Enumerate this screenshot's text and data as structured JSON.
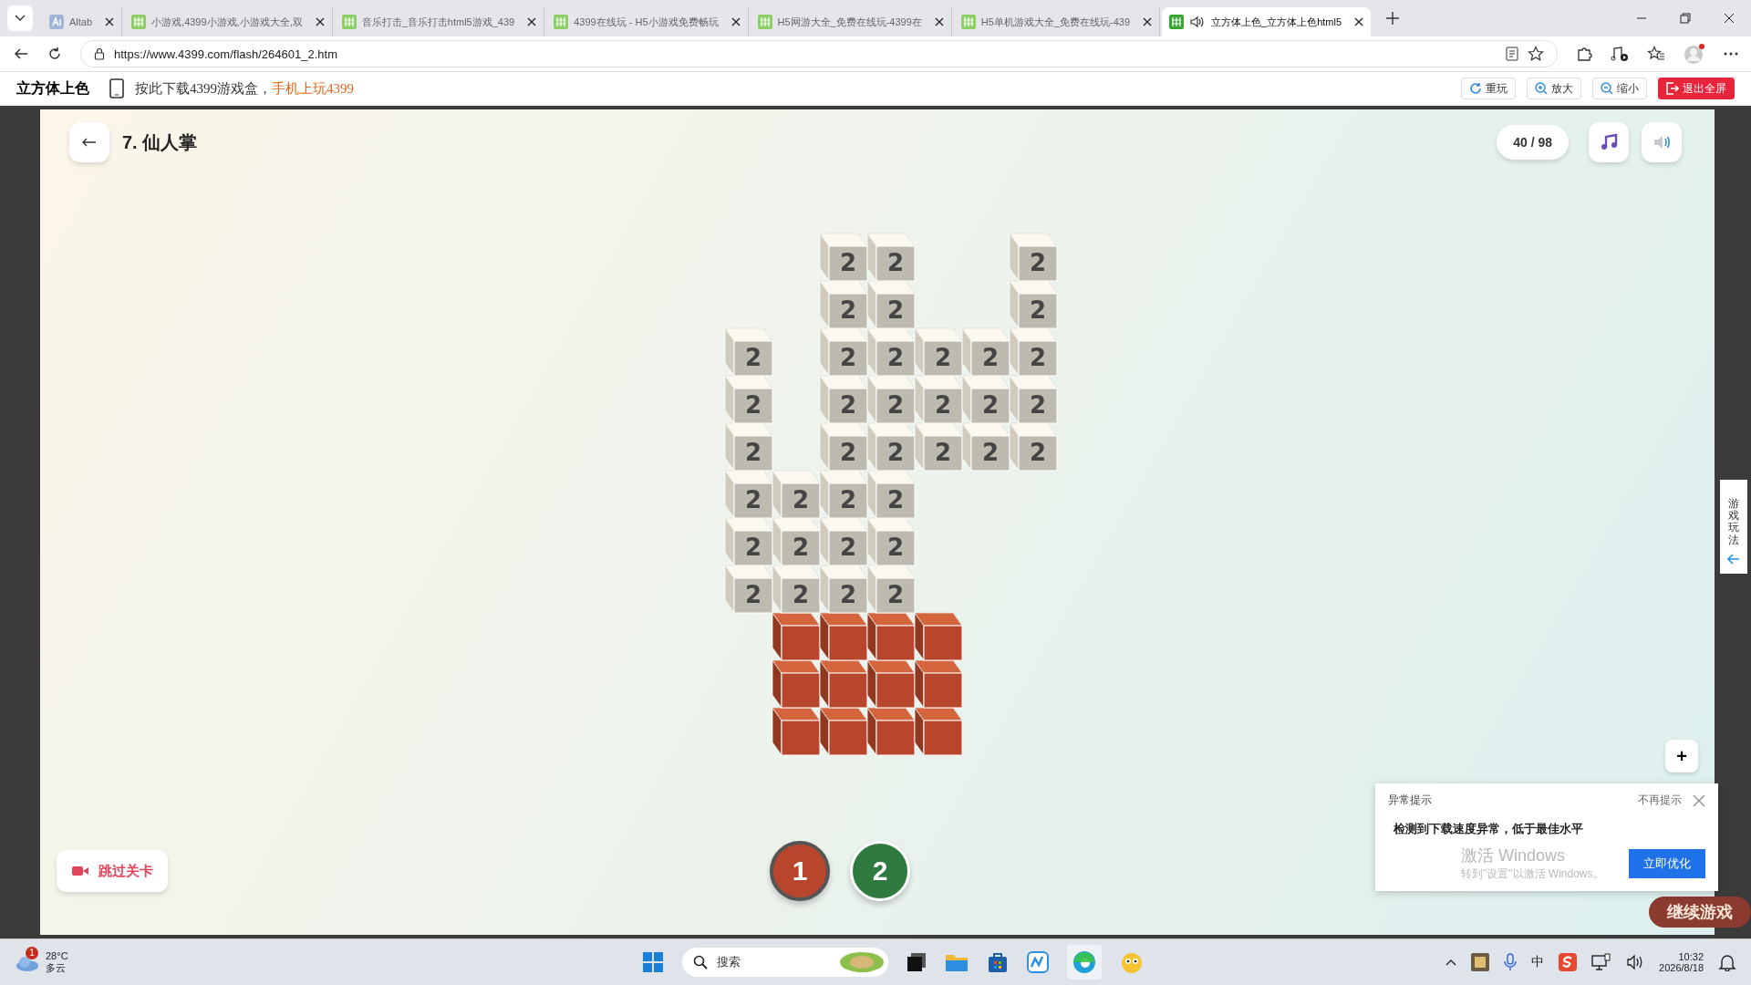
{
  "browser": {
    "tabs": [
      {
        "title": "Altab",
        "selected": false
      },
      {
        "title": "小游戏,4399小游戏,小游戏大全,双",
        "selected": false
      },
      {
        "title": "音乐打击_音乐打击html5游戏_439",
        "selected": false
      },
      {
        "title": "4399在线玩 - H5小游戏免费畅玩",
        "selected": false
      },
      {
        "title": "H5网游大全_免费在线玩-4399在",
        "selected": false
      },
      {
        "title": "H5单机游戏大全_免费在线玩-439",
        "selected": false
      },
      {
        "title": "立方体上色_立方体上色html5",
        "selected": true
      }
    ],
    "url": "https://www.4399.com/flash/264601_2.htm"
  },
  "site_bar": {
    "title": "立方体上色",
    "download_text": "按此下载4399游戏盒，",
    "download_link": "手机上玩4399",
    "buttons": [
      {
        "label": "重玩",
        "kind": "replay"
      },
      {
        "label": "放大",
        "kind": "zoom-in"
      },
      {
        "label": "缩小",
        "kind": "zoom-out"
      },
      {
        "label": "退出全屏",
        "kind": "exit"
      }
    ]
  },
  "game": {
    "level_title": "7. 仙人掌",
    "progress": "40 / 98",
    "side_tab": "游戏玩法",
    "skip_button": "跳过关卡",
    "zoom_button": "+",
    "grid": [
      {
        "cells": [
          null,
          null,
          {
            "label": "2",
            "painted": false
          },
          {
            "label": "2",
            "painted": false
          },
          null,
          null,
          {
            "label": "2",
            "painted": false
          }
        ]
      },
      {
        "cells": [
          null,
          null,
          {
            "label": "2",
            "painted": false
          },
          {
            "label": "2",
            "painted": false
          },
          null,
          null,
          {
            "label": "2",
            "painted": false
          }
        ]
      },
      {
        "cells": [
          {
            "label": "2",
            "painted": false
          },
          null,
          {
            "label": "2",
            "painted": false
          },
          {
            "label": "2",
            "painted": false
          },
          {
            "label": "2",
            "painted": false
          },
          {
            "label": "2",
            "painted": false
          },
          {
            "label": "2",
            "painted": false
          }
        ]
      },
      {
        "cells": [
          {
            "label": "2",
            "painted": false
          },
          null,
          {
            "label": "2",
            "painted": false
          },
          {
            "label": "2",
            "painted": false
          },
          {
            "label": "2",
            "painted": false
          },
          {
            "label": "2",
            "painted": false
          },
          {
            "label": "2",
            "painted": false
          }
        ]
      },
      {
        "cells": [
          {
            "label": "2",
            "painted": false
          },
          null,
          {
            "label": "2",
            "painted": false
          },
          {
            "label": "2",
            "painted": false
          },
          {
            "label": "2",
            "painted": false
          },
          {
            "label": "2",
            "painted": false
          },
          {
            "label": "2",
            "painted": false
          }
        ]
      },
      {
        "cells": [
          {
            "label": "2",
            "painted": false
          },
          {
            "label": "2",
            "painted": false
          },
          {
            "label": "2",
            "painted": false
          },
          {
            "label": "2",
            "painted": false
          },
          null,
          null,
          null
        ]
      },
      {
        "cells": [
          {
            "label": "2",
            "painted": false
          },
          {
            "label": "2",
            "painted": false
          },
          {
            "label": "2",
            "painted": false
          },
          {
            "label": "2",
            "painted": false
          },
          null,
          null,
          null
        ]
      },
      {
        "cells": [
          {
            "label": "2",
            "painted": false
          },
          {
            "label": "2",
            "painted": false
          },
          {
            "label": "2",
            "painted": false
          },
          {
            "label": "2",
            "painted": false
          },
          null,
          null,
          null
        ]
      },
      {
        "cells": [
          null,
          {
            "painted": true
          },
          {
            "painted": true
          },
          {
            "painted": true
          },
          {
            "painted": true
          },
          null,
          null
        ]
      },
      {
        "cells": [
          null,
          {
            "painted": true
          },
          {
            "painted": true
          },
          {
            "painted": true
          },
          {
            "painted": true
          },
          null,
          null
        ]
      },
      {
        "cells": [
          null,
          {
            "painted": true
          },
          {
            "painted": true
          },
          {
            "painted": true
          },
          {
            "painted": true
          },
          null,
          null
        ]
      }
    ],
    "palette": [
      {
        "label": "1",
        "color": "#b8462c",
        "selected": true
      },
      {
        "label": "2",
        "color": "#2f7a3e",
        "selected": false
      }
    ],
    "continue_button": "继续游戏"
  },
  "popup": {
    "title": "异常提示",
    "dismiss": "不再提示",
    "message": "检测到下载速度异常，低于最佳水平",
    "action": "立即优化"
  },
  "activation": {
    "title": "激活 Windows",
    "hint": "转到\"设置\"以激活 Windows。"
  },
  "taskbar": {
    "weather_badge": "1",
    "temperature": "28°C",
    "condition": "多云",
    "search": "搜索",
    "time": "10:32",
    "date": "2026/8/18",
    "ime": "中"
  }
}
